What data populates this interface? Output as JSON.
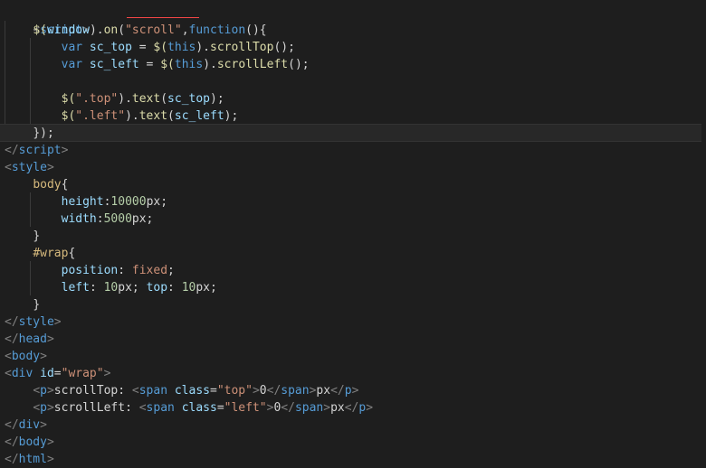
{
  "code": {
    "line0": [
      " ",
      "",
      ""
    ],
    "l1": {
      "open": "<",
      "name": "script",
      "close": ">"
    },
    "l2": {
      "a": "$(",
      "b": "window",
      "c": ").",
      "d": "on",
      "e": "(",
      "f": "\"scroll\"",
      "g": ",",
      "h": "function",
      "i": "(){"
    },
    "l3": {
      "a": "var",
      "b": " sc_top",
      "c": " = ",
      "d": "$(",
      "e": "this",
      "f": ").",
      "g": "scrollTop",
      "h": "();"
    },
    "l4": {
      "a": "var",
      "b": " sc_left",
      "c": " = ",
      "d": "$(",
      "e": "this",
      "f": ").",
      "g": "scrollLeft",
      "h": "();"
    },
    "l6": {
      "a": "$(",
      "b": "\".top\"",
      "c": ").",
      "d": "text",
      "e": "(",
      "f": "sc_top",
      "g": ");"
    },
    "l7": {
      "a": "$(",
      "b": "\".left\"",
      "c": ").",
      "d": "text",
      "e": "(",
      "f": "sc_left",
      "g": ");"
    },
    "l8": "});",
    "l9": {
      "open": "</",
      "name": "script",
      "close": ">"
    },
    "l10": {
      "open": "<",
      "name": "style",
      "close": ">"
    },
    "l11": {
      "sel": "body",
      "brace": "{"
    },
    "l12": {
      "prop": "height",
      "colon": ":",
      "val": "10000",
      "unit": "px;"
    },
    "l13": {
      "prop": "width",
      "colon": ":",
      "val": "5000",
      "unit": "px;"
    },
    "l14": "}",
    "l15": {
      "sel": "#wrap",
      "brace": "{"
    },
    "l16": {
      "prop": "position",
      "colon": ": ",
      "val": "fixed",
      "semi": ";"
    },
    "l17": {
      "p1": "left",
      "c1": ": ",
      "v1": "10",
      "u1": "px; ",
      "p2": "top",
      "c2": ": ",
      "v2": "10",
      "u2": "px;"
    },
    "l18": "}",
    "l19": {
      "open": "</",
      "name": "style",
      "close": ">"
    },
    "l20": {
      "open": "</",
      "name": "head",
      "close": ">"
    },
    "l21": {
      "open": "<",
      "name": "body",
      "close": ">"
    },
    "l22": {
      "open": "<",
      "name": "div",
      "sp": " ",
      "attr": "id",
      "eq": "=",
      "val": "\"wrap\"",
      "close": ">"
    },
    "l23": {
      "a": "<",
      "b": "p",
      "c": ">",
      "d": "scrollTop: ",
      "e": "<",
      "f": "span",
      "g": " ",
      "h": "class",
      "i": "=",
      "j": "\"top\"",
      "k": ">",
      "l": "0",
      "m": "</",
      "n": "span",
      "o": ">",
      "p": "px",
      "q": "</",
      "r": "p",
      "s": ">"
    },
    "l24": {
      "a": "<",
      "b": "p",
      "c": ">",
      "d": "scrollLeft: ",
      "e": "<",
      "f": "span",
      "g": " ",
      "h": "class",
      "i": "=",
      "j": "\"left\"",
      "k": ">",
      "l": "0",
      "m": "</",
      "n": "span",
      "o": ">",
      "p": "px",
      "q": "</",
      "r": "p",
      "s": ">"
    },
    "l25": {
      "open": "</",
      "name": "div",
      "close": ">"
    },
    "l26": {
      "open": "</",
      "name": "body",
      "close": ">"
    },
    "l27": {
      "open": "</",
      "name": "html",
      "close": ">"
    }
  }
}
